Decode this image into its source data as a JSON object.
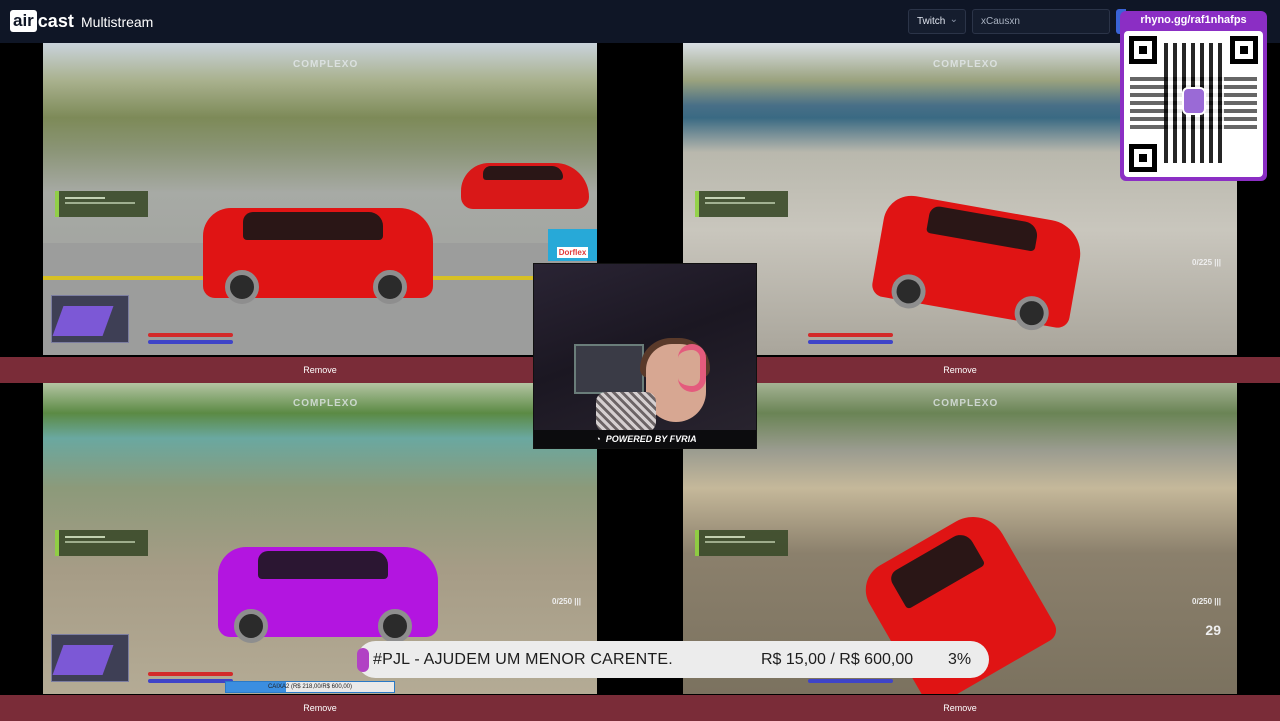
{
  "app": {
    "logo_part1": "air",
    "logo_part2": "cast",
    "title": "Multistream"
  },
  "header": {
    "platform_select": "Twitch",
    "platform_chevron": "⌄",
    "channel_input": "xCausxn"
  },
  "panels": [
    {
      "remove_label": "Remove",
      "watermark": "COMPLEXO"
    },
    {
      "remove_label": "Remove",
      "watermark": "COMPLEXO",
      "speed": "0/225 |||"
    },
    {
      "remove_label": "Remove",
      "watermark": "COMPLEXO",
      "speed": "0/250 |||"
    },
    {
      "remove_label": "Remove",
      "watermark": "COMPLEXO",
      "speed": "0/250 |||",
      "gear": "29"
    }
  ],
  "webcam": {
    "powered_by": "POWERED BY FVRIA"
  },
  "qr": {
    "url": "rhyno.gg/raf1nhafps"
  },
  "sponsor": {
    "label": "Dorflex"
  },
  "donation": {
    "message": "#PJL - AJUDEM UM MENOR CARENTE.",
    "amount": "R$ 15,00 / R$ 600,00",
    "percent": "3%",
    "progress": 0.03
  },
  "goal": {
    "text": "CAIXA2 (R$ 218,00/R$ 600,00)",
    "progress": 0.36
  },
  "colors": {
    "header_bg": "#0f1626",
    "remove_bar": "#7a2c38",
    "qr_border": "#8b2ec4",
    "car_red": "#e01414",
    "car_purple": "#b315e0"
  }
}
